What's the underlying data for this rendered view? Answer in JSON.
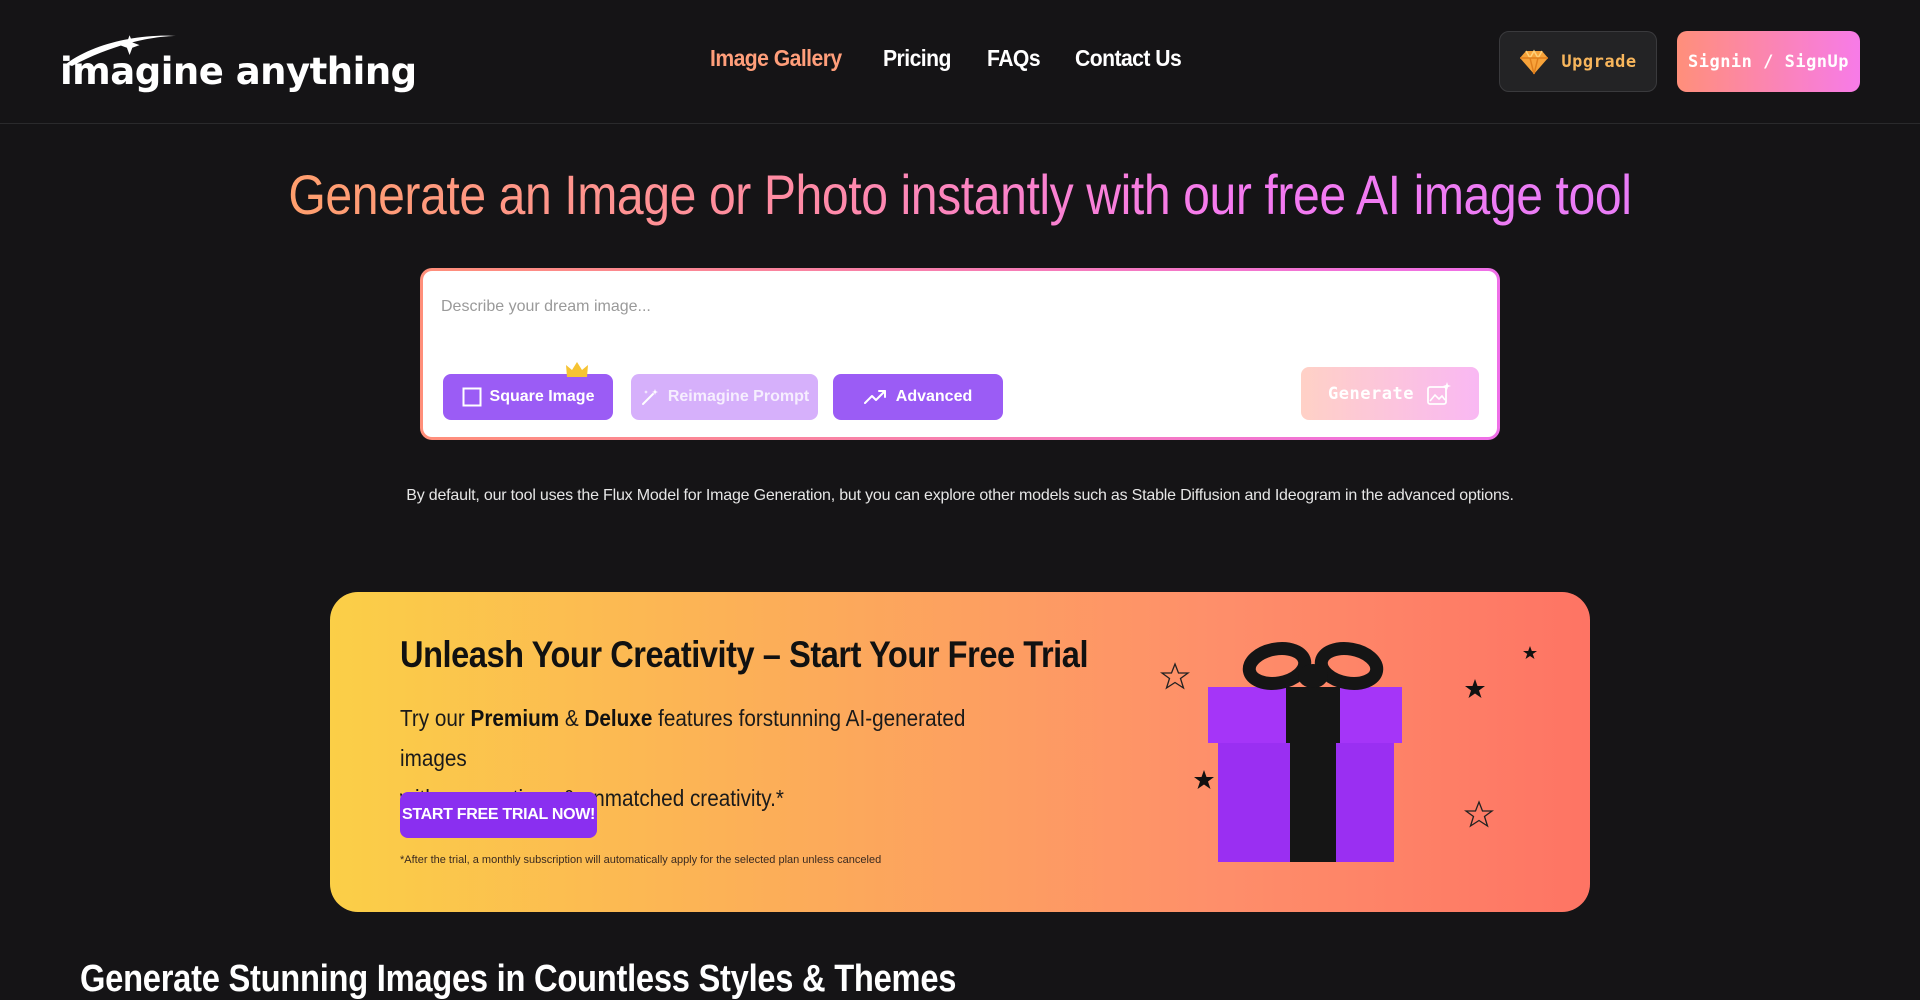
{
  "header": {
    "logo_text": "imagine anything",
    "nav": [
      {
        "label": "Image Gallery",
        "active": true
      },
      {
        "label": "Pricing",
        "active": false
      },
      {
        "label": "FAQs",
        "active": false
      },
      {
        "label": "Contact Us",
        "active": false
      }
    ],
    "upgrade_label": "Upgrade",
    "signin_label": "Signin / SignUp"
  },
  "hero": {
    "title_part1": "Generate an Image or",
    "title_part2": "Photo instantly with our free AI image tool",
    "prompt_placeholder": "Describe your dream image...",
    "prompt_value": "",
    "square_label": "Square Image",
    "reimagine_label": "Reimagine Prompt",
    "advanced_label": "Advanced",
    "generate_label": "Generate",
    "note": "By default, our tool uses the Flux Model for Image Generation, but you can explore other models such as Stable Diffusion and Ideogram in the advanced options."
  },
  "banner": {
    "title": "Unleash Your Creativity – Start Your Free Trial",
    "text_1": "Try our ",
    "premium": "Premium",
    "amp": " & ",
    "deluxe": "Deluxe",
    "text_2": " features forstunning AI-generated images",
    "text_3": "with moreoptions & unmatched creativity.*",
    "cta_label": "START FREE TRIAL NOW!",
    "fineprint": "*After the trial, a monthly subscription will automatically apply for the selected plan unless canceled"
  },
  "section": {
    "title": "Generate Stunning Images in Countless Styles & Themes"
  },
  "colors": {
    "background": "#151416",
    "accent_orange": "#ff9e7a",
    "accent_pink": "#f77be8",
    "purple": "#9b5cf5",
    "upgrade_text": "#f8b65c"
  },
  "icons": [
    "logo-sparkle-icon",
    "diamond-icon",
    "square-icon",
    "crown-icon",
    "magic-wand-icon",
    "trending-up-icon",
    "image-sparkle-icon",
    "gift-icon",
    "star-icon"
  ]
}
